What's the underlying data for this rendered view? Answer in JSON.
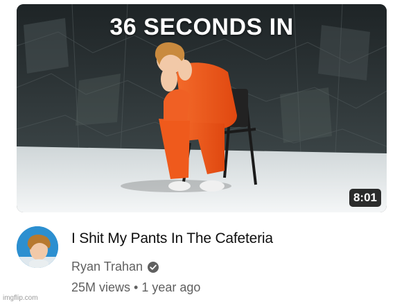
{
  "video": {
    "thumbnail_overlay_text": "36 SECONDS IN",
    "duration": "8:01",
    "title": "I Shit My Pants In The Cafeteria",
    "channel_name": "Ryan Trahan",
    "channel_verified": true,
    "views": "25M views",
    "separator": "•",
    "age": "1 year ago"
  },
  "watermark": "imgflip.com",
  "colors": {
    "jumpsuit": "#f2561b",
    "room_wall": "#2f3638",
    "floor": "#e8ecee",
    "duration_bg": "#000000",
    "avatar_bg": "#2c8fd0"
  },
  "icons": [
    "verified-check-icon"
  ]
}
